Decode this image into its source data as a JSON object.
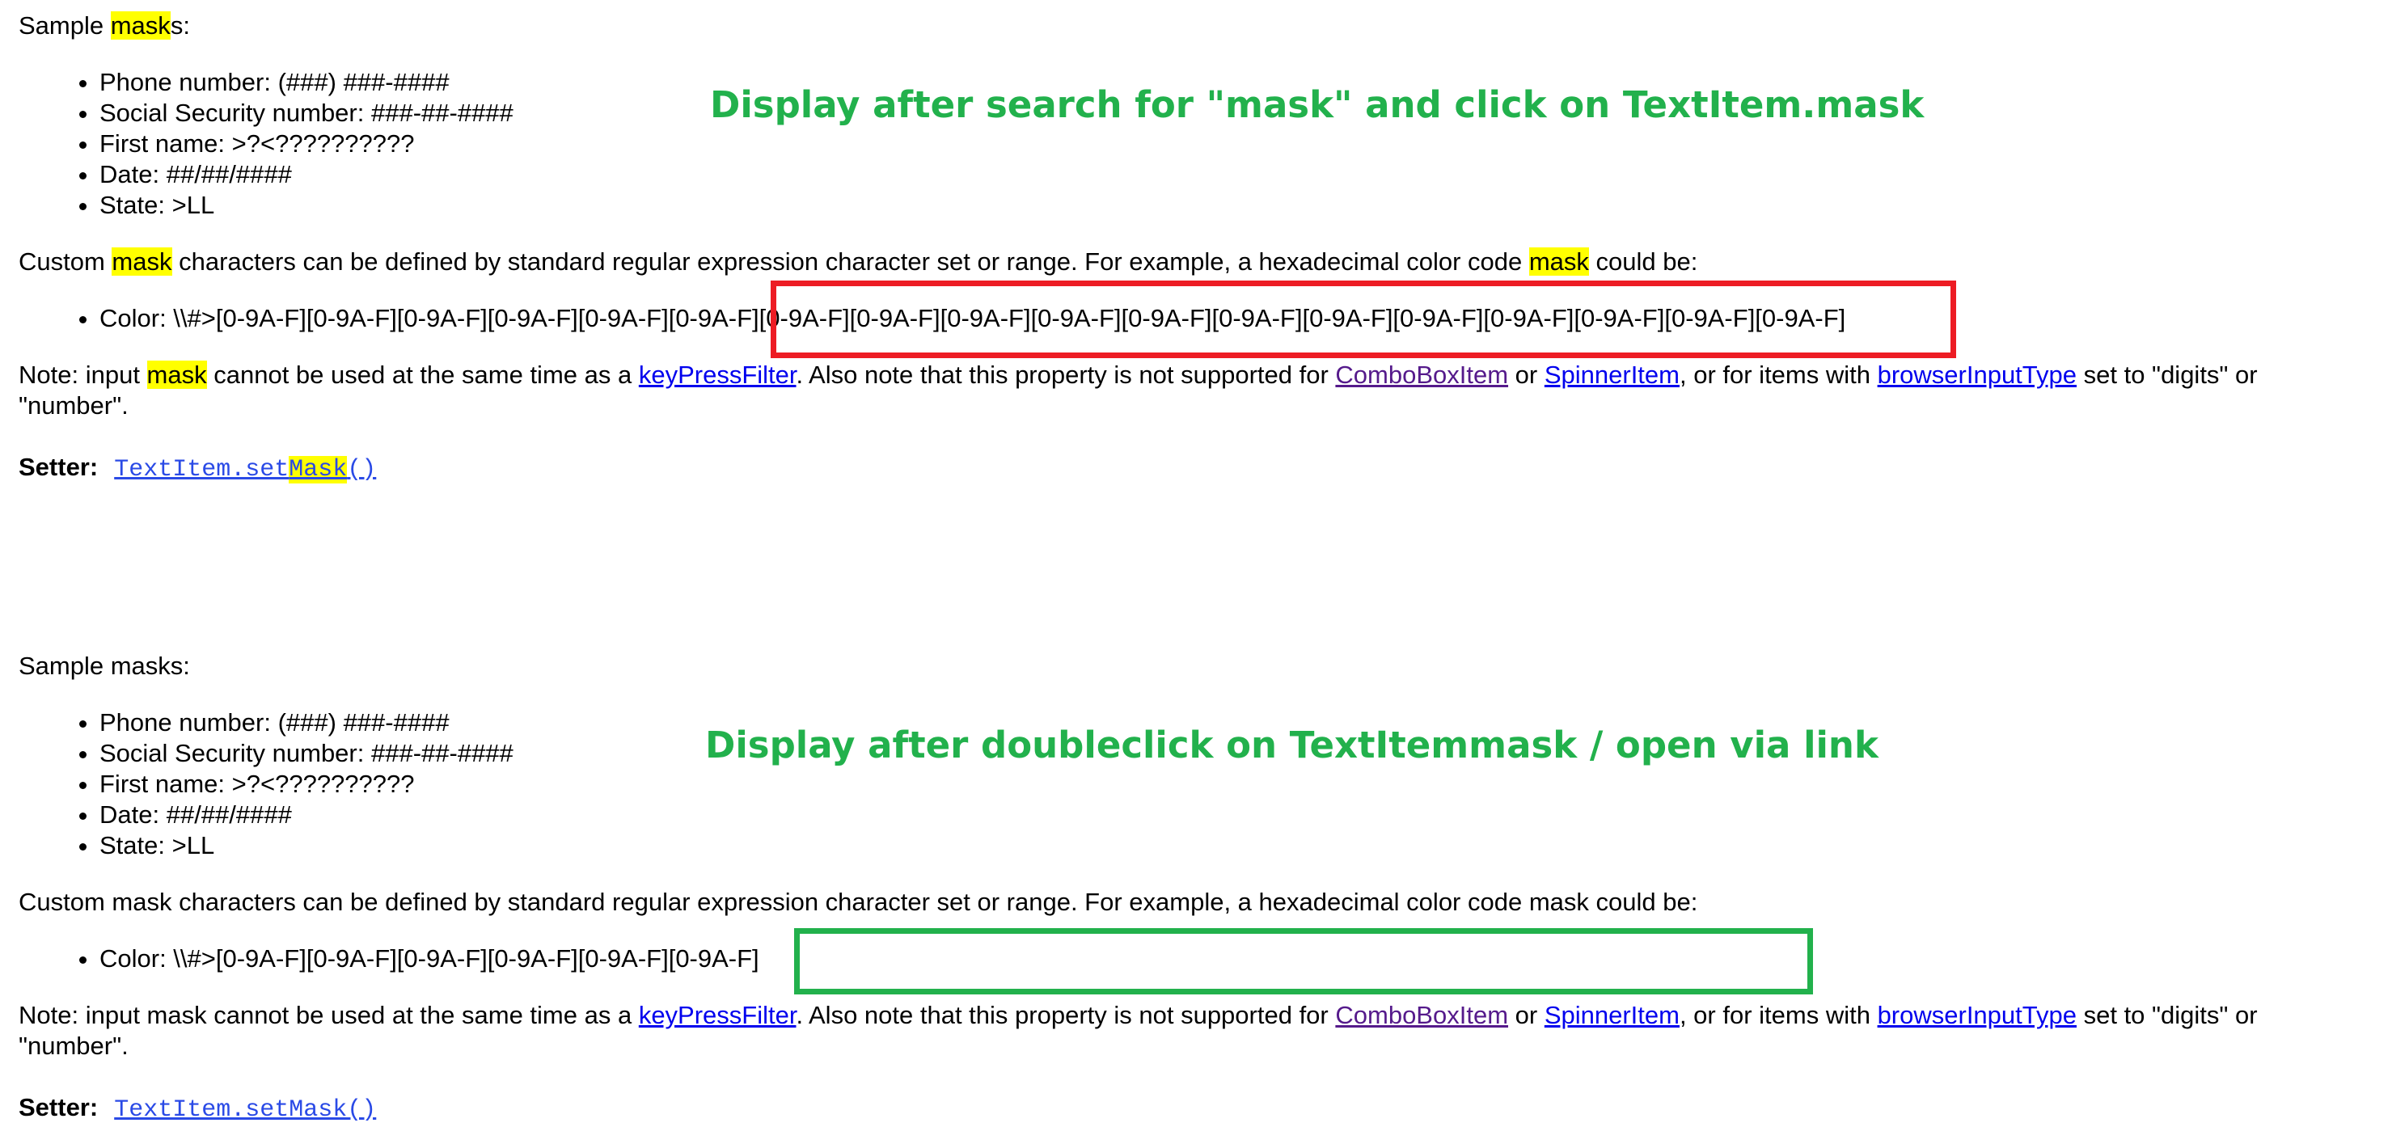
{
  "panel_1": {
    "sample_prefix": "Sample ",
    "sample_highlight": "mask",
    "sample_suffix": "s:",
    "list": [
      "Phone number: (###) ###-####",
      "Social Security number: ###-##-####",
      "First name: >?<??????????",
      "Date: ##/##/####",
      "State: >LL"
    ],
    "custom_part1": "Custom ",
    "custom_hl1": "mask",
    "custom_part2": " characters can be defined by standard regular expression character set or range. For example, a hexadecimal color code ",
    "custom_hl2": "mask",
    "custom_part3": " could be:",
    "color_item": "Color: \\\\#>[0-9A-F][0-9A-F][0-9A-F][0-9A-F][0-9A-F][0-9A-F][0-9A-F][0-9A-F][0-9A-F][0-9A-F][0-9A-F][0-9A-F][0-9A-F][0-9A-F][0-9A-F][0-9A-F][0-9A-F][0-9A-F]",
    "note_part1": "Note: input ",
    "note_hl": "mask",
    "note_part2": " cannot be used at the same time as a ",
    "link_keypress": "keyPressFilter",
    "note_part3": ". Also note that this property is not supported for ",
    "link_combo": "ComboBoxItem",
    "note_part4": " or ",
    "link_spinner": "SpinnerItem",
    "note_part5": ", or for items with ",
    "link_browser": "browserInputType",
    "note_part6": " set to \"digits\" or \"number\".",
    "setter_label": "Setter:",
    "setter_link_prefix": "TextItem.set",
    "setter_link_hl": "Mask",
    "setter_link_suffix": "()"
  },
  "panel_2": {
    "sample_text": "Sample masks:",
    "list": [
      "Phone number: (###) ###-####",
      "Social Security number: ###-##-####",
      "First name: >?<??????????",
      "Date: ##/##/####",
      "State: >LL"
    ],
    "custom_text": "Custom mask characters can be defined by standard regular expression character set or range. For example, a hexadecimal color code mask could be:",
    "color_item": "Color: \\\\#>[0-9A-F][0-9A-F][0-9A-F][0-9A-F][0-9A-F][0-9A-F]",
    "note_part1": "Note: input mask cannot be used at the same time as a ",
    "link_keypress": "keyPressFilter",
    "note_part2": ". Also note that this property is not supported for ",
    "link_combo": "ComboBoxItem",
    "note_part3": " or ",
    "link_spinner": "SpinnerItem",
    "note_part4": ", or for items with ",
    "link_browser": "browserInputType",
    "note_part5": " set to \"digits\" or \"number\".",
    "setter_label": "Setter:",
    "setter_link": "TextItem.setMask()"
  },
  "annotations": {
    "caption_1": "Display after search for \"mask\" and click on TextItem.mask",
    "caption_2": "Display after doubleclick on TextItemmask / open via link",
    "caption_color": "#22b14c",
    "box_red_color": "#ed1c24",
    "box_green_color": "#22b14c",
    "highlight_color": "#ffff00"
  }
}
